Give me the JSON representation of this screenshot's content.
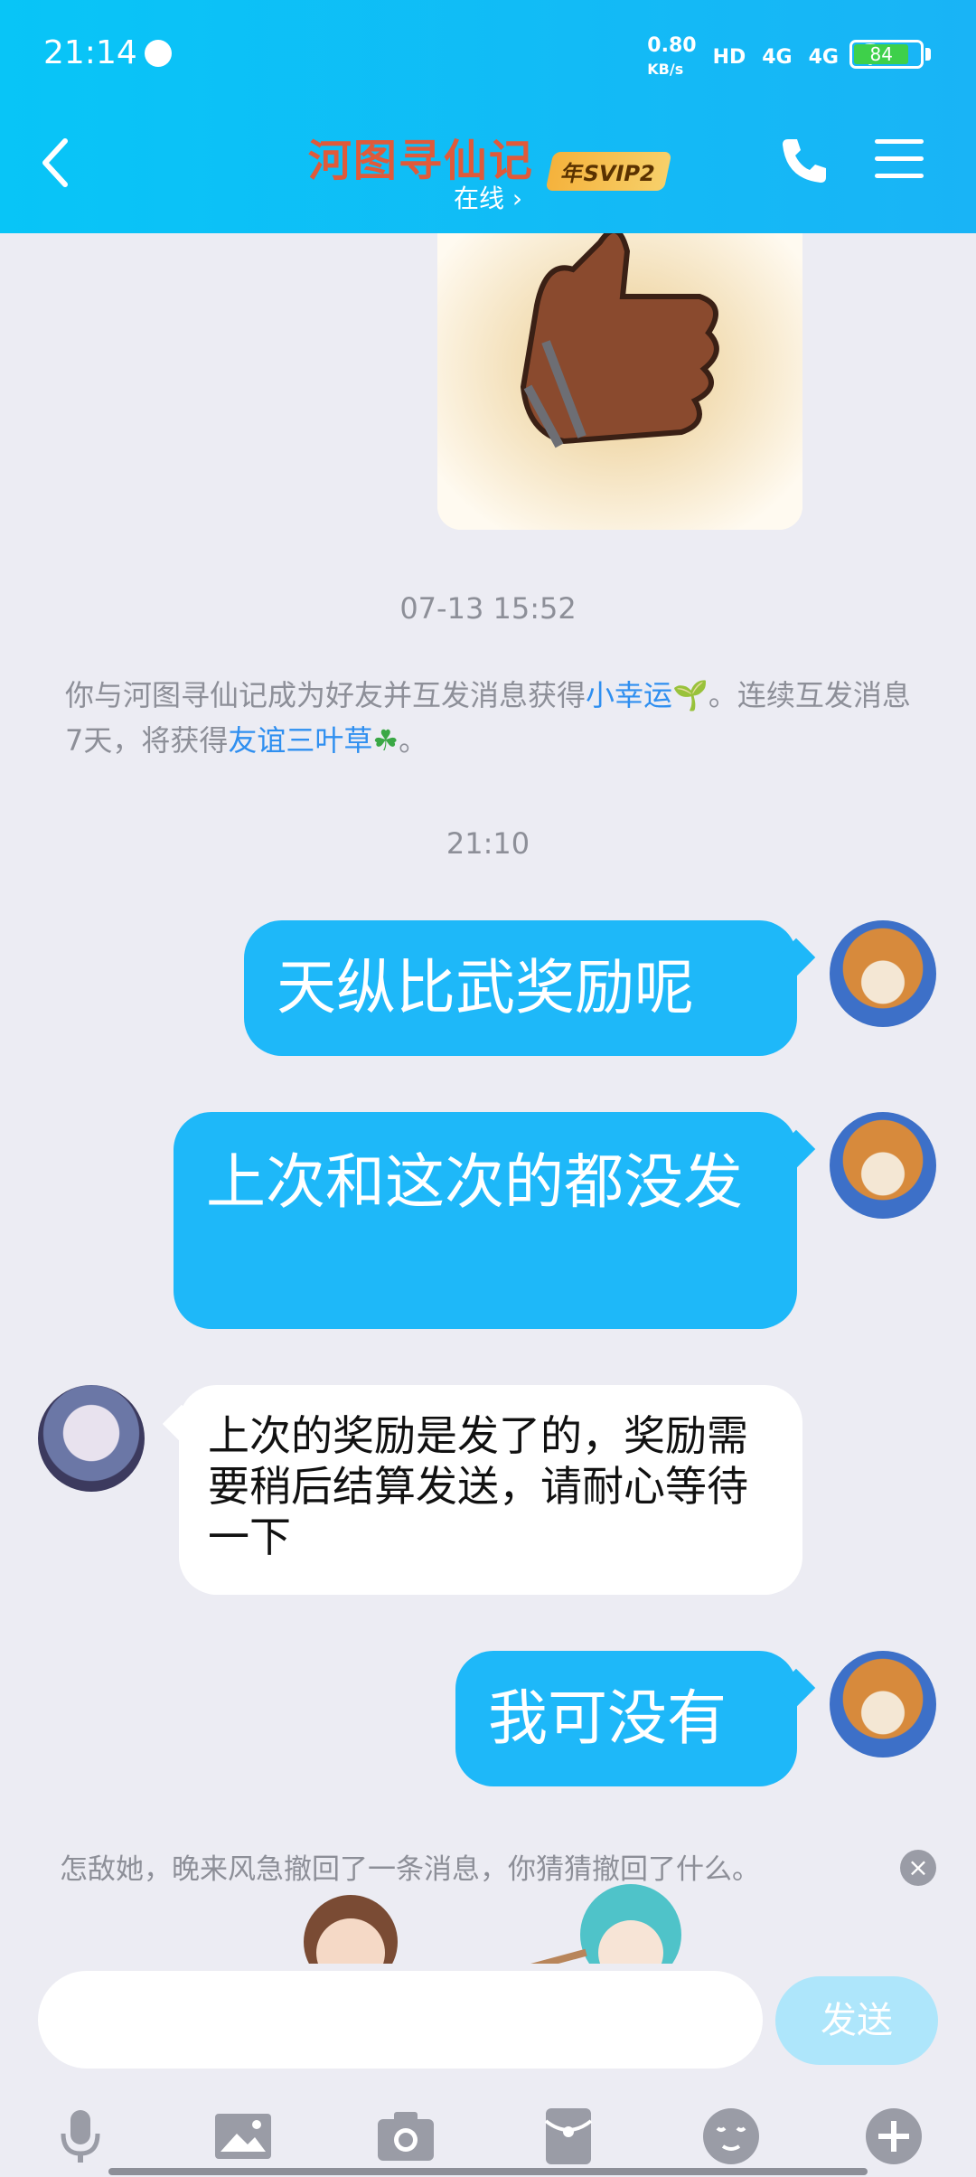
{
  "status": {
    "time": "21:14",
    "net_speed": "0.80",
    "net_unit": "KB/s",
    "hd": "HD",
    "signal1": "4G",
    "signal2": "4G",
    "battery": "84"
  },
  "header": {
    "title": "河图寻仙记",
    "badge": "年SVIP2",
    "subtitle": "在线 ›"
  },
  "chat": {
    "timestamp1": "07-13 15:52",
    "system": {
      "part1": "你与河图寻仙记成为好友并互发消息获得",
      "link1": "小幸运",
      "part2": "。连续互发消息7天，将获得",
      "link2": "友谊三叶草",
      "part3": "。"
    },
    "timestamp2": "21:10",
    "messages": [
      {
        "text": "天纵比武奖励呢"
      },
      {
        "text": "上次和这次的都没发"
      },
      {
        "text": "上次的奖励是发了的，奖励需要稍后结算发送，请耐心等待一下"
      },
      {
        "text": "我可没有"
      }
    ],
    "recall_notice": "怎敌她，晚来风急撤回了一条消息，你猜猜撤回了什么。"
  },
  "input": {
    "placeholder": "",
    "send_label": "发送"
  },
  "colors": {
    "accent": "#1eb8f9",
    "header": "#08c5f7",
    "title": "#e05a3a"
  }
}
